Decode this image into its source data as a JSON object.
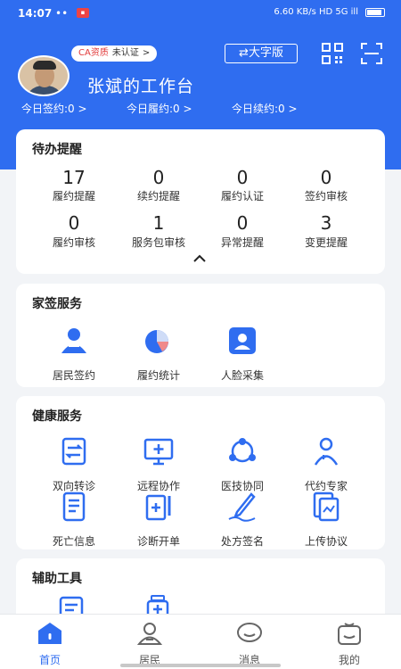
{
  "status_bar": {
    "time": "14:07",
    "dots": "••",
    "right_info": "6.60 KB/s  HD  5G  ill"
  },
  "header": {
    "ca_label": "CA资质",
    "ca_status": "未认证",
    "ca_arrow": ">",
    "title": "张斌的工作台",
    "bigfont_label": "⇄大字版",
    "stats": [
      {
        "label": "今日签约:0 >"
      },
      {
        "label": "今日履约:0 >"
      },
      {
        "label": "今日续约:0 >"
      }
    ]
  },
  "todo": {
    "title": "待办提醒",
    "items": [
      {
        "value": "17",
        "label": "履约提醒"
      },
      {
        "value": "0",
        "label": "续约提醒"
      },
      {
        "value": "0",
        "label": "履约认证"
      },
      {
        "value": "0",
        "label": "签约审核"
      },
      {
        "value": "0",
        "label": "履约审核"
      },
      {
        "value": "1",
        "label": "服务包审核"
      },
      {
        "value": "0",
        "label": "异常提醒"
      },
      {
        "value": "3",
        "label": "变更提醒"
      }
    ]
  },
  "family_service": {
    "title": "家签服务",
    "items": [
      {
        "label": "居民签约",
        "icon": "resident-sign-icon"
      },
      {
        "label": "履约统计",
        "icon": "pie-chart-icon"
      },
      {
        "label": "人脸采集",
        "icon": "face-capture-icon"
      }
    ]
  },
  "health_service": {
    "title": "健康服务",
    "items": [
      {
        "label": "双向转诊",
        "icon": "referral-icon"
      },
      {
        "label": "远程协作",
        "icon": "remote-monitor-icon"
      },
      {
        "label": "医技协同",
        "icon": "network-icon"
      },
      {
        "label": "代约专家",
        "icon": "doctor-icon"
      },
      {
        "label": "死亡信息",
        "icon": "document-list-icon"
      },
      {
        "label": "诊断开单",
        "icon": "diagnosis-icon"
      },
      {
        "label": "处方签名",
        "icon": "signature-pen-icon"
      },
      {
        "label": "上传协议",
        "icon": "upload-document-icon"
      }
    ]
  },
  "aux_tools": {
    "title": "辅助工具"
  },
  "tabbar": {
    "tabs": [
      {
        "label": "首页",
        "icon": "home-icon",
        "active": true
      },
      {
        "label": "居民",
        "icon": "person-icon",
        "active": false
      },
      {
        "label": "消息",
        "icon": "message-icon",
        "active": false
      },
      {
        "label": "我的",
        "icon": "profile-icon",
        "active": false
      }
    ]
  },
  "colors": {
    "primary": "#2f6df0",
    "accent_red": "#e23b3b",
    "background": "#f2f4f7"
  }
}
